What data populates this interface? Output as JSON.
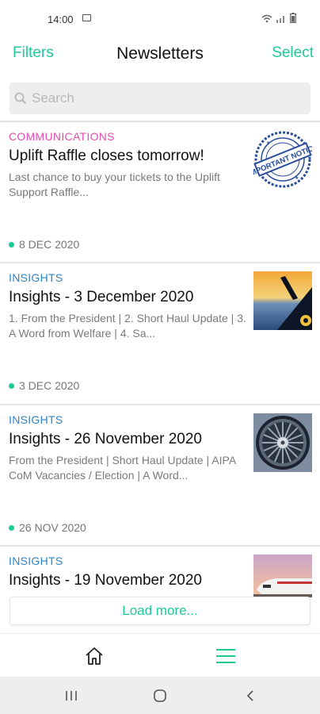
{
  "status_bar": {
    "time": "14:00"
  },
  "header": {
    "filters_label": "Filters",
    "title": "Newsletters",
    "select_label": "Select"
  },
  "search": {
    "placeholder": "Search"
  },
  "newsletters": [
    {
      "category": "COMMUNICATIONS",
      "category_color": "#e84bb0",
      "title": "Uplift Raffle closes tomorrow!",
      "description": "Last chance to buy your tickets to the Uplift Support Raffle...",
      "date": "8 DEC 2020",
      "thumbnail": "important-notice-stamp",
      "stamp_text": "IMPORTANT NOTICE"
    },
    {
      "category": "INSIGHTS",
      "category_color": "#2e84c4",
      "title": "Insights - 3 December 2020",
      "description": "1. From the President | 2. Short Haul Update | 3. A Word from Welfare | 4. Sa...",
      "date": "3 DEC 2020",
      "thumbnail": "aircraft-wing-sunset"
    },
    {
      "category": "INSIGHTS",
      "category_color": "#2e84c4",
      "title": "Insights - 26 November 2020",
      "description": "From the President | Short Haul Update | AIPA CoM Vacancies / Election | A Word...",
      "date": "26 NOV 2020",
      "thumbnail": "jet-engine"
    },
    {
      "category": "INSIGHTS",
      "category_color": "#2e84c4",
      "title": "Insights - 19 November 2020",
      "thumbnail": "aircraft-nose"
    }
  ],
  "load_more_label": "Load more...",
  "colors": {
    "accent": "#1ec998",
    "divider": "#e3e3e3"
  },
  "tabs": [
    {
      "icon": "home-icon",
      "active": false
    },
    {
      "icon": "menu-icon",
      "active": true
    }
  ],
  "system_nav": [
    "recent-apps-icon",
    "home-circle-icon",
    "back-icon"
  ]
}
